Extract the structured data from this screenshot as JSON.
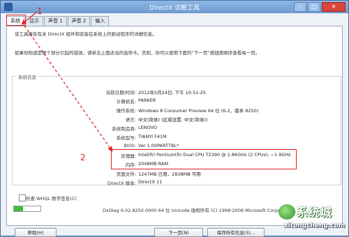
{
  "window": {
    "title": "DirectX 诊断工具"
  },
  "tabs": [
    {
      "label": "系统"
    },
    {
      "label": "显示"
    },
    {
      "label": "声音 1"
    },
    {
      "label": "声音 2"
    },
    {
      "label": "输入"
    }
  ],
  "intro": {
    "line1": "该工具报告有关 DirectX 组件和安装在系统上的驱动程序的详细信息。",
    "line2": "如果你知道是哪个部分引起的错误，请单击上面适当的选项卡。否则，你可以使用下面的“下一页”按钮按顺序查看每一页。"
  },
  "sysinfo": {
    "group_title": "系统信息",
    "rows": [
      {
        "label": "当前日期/时间:",
        "value": "2012年5月24日, 下午 10:51:25"
      },
      {
        "label": "计算机名:",
        "value": "PARKER"
      },
      {
        "label": "操作系统:",
        "value": "Windows 8 Consumer Preview 64 位 (6.2，版本 8250)"
      },
      {
        "label": "语言:",
        "value": "中文(简体) (区域设置: 中文(简体))"
      },
      {
        "label": "系统制造商:",
        "value": "LENOVO"
      },
      {
        "label": "系统型号:",
        "value": "TIANYI F41M"
      },
      {
        "label": "BIOS:",
        "value": "Ver 1.00PARTTBL*"
      },
      {
        "label": "处理器:",
        "value": "Intel(R) Pentium(R) Dual  CPU  T2390  @ 1.86GHz (2 CPUs), ~1.9GHz"
      },
      {
        "label": "内存:",
        "value": "2048MB RAM"
      },
      {
        "label": "页面文件:",
        "value": "1247MB 已用，2838MB 可用"
      },
      {
        "label": "DirectX 版本:",
        "value": "DirectX 11"
      }
    ]
  },
  "whql": {
    "label": "检查 WHQL 数字签名(C)",
    "checked": false
  },
  "progress": {
    "fraction": 0.35
  },
  "copyright": "DxDiag 6.02.8250.0000 64 位 Unicode 版权所有 (C) 1998-2006 Microsoft Corporation。",
  "buttons": {
    "help": "帮助(H)",
    "next": "下一页(N)",
    "save": "保存所有信息(S)..."
  },
  "annotations": {
    "one": "1",
    "two": "2"
  },
  "watermark": {
    "brand": "系统城",
    "url": "xitongcheng.com"
  },
  "colors": {
    "annotation_red": "#e02020",
    "progress_green": "#3fbe3f",
    "titlebar": "#7ba7dc"
  }
}
